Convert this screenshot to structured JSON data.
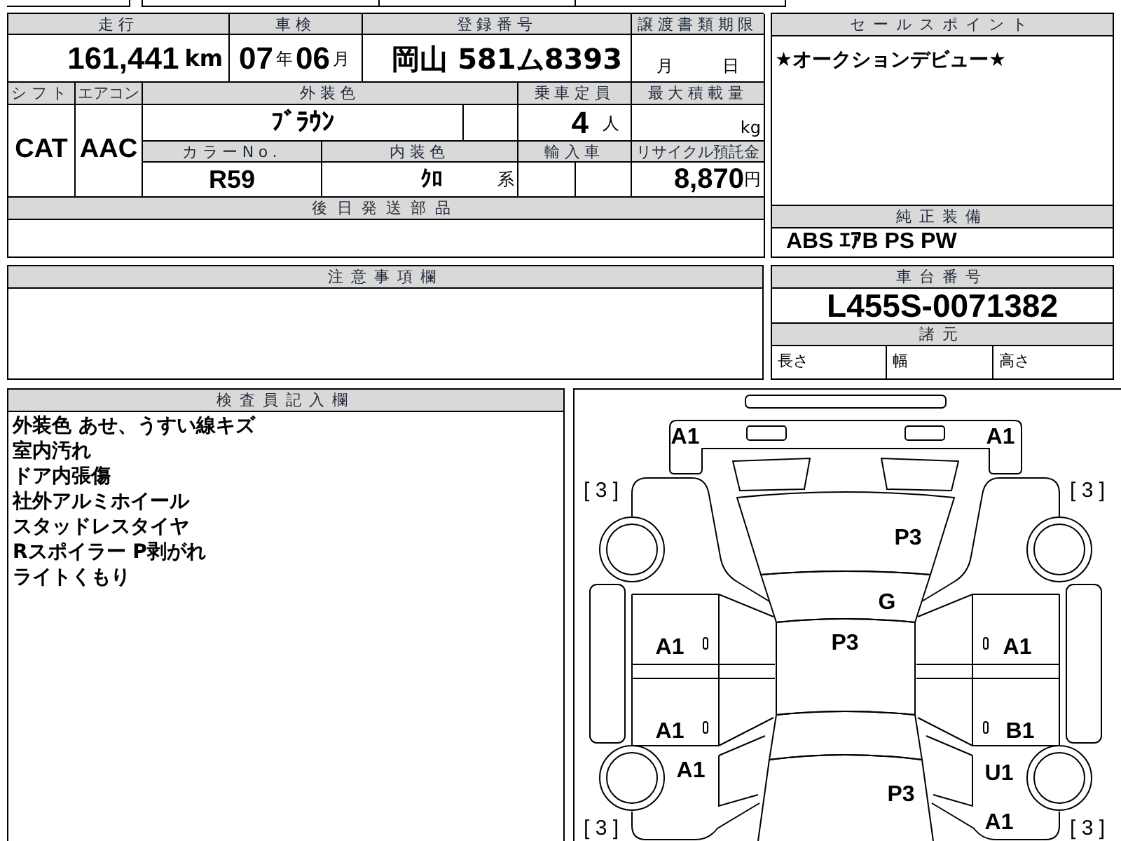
{
  "mileage": {
    "label": "走行",
    "value": "161,441",
    "unit": "km"
  },
  "inspection": {
    "label": "車検",
    "year": "07",
    "year_unit": "年",
    "month": "06",
    "month_unit": "月"
  },
  "registration": {
    "label": "登録番号",
    "value": "岡山 581ム8393"
  },
  "transfer_deadline": {
    "label": "譲渡書類期限",
    "month_unit": "月",
    "day_unit": "日"
  },
  "shift": {
    "label": "シフト",
    "value": "CAT"
  },
  "aircon": {
    "label": "エアコン",
    "value": "AAC"
  },
  "exterior_color": {
    "label": "外装色",
    "value": "ﾌﾞﾗｳﾝ"
  },
  "capacity": {
    "label": "乗車定員",
    "value": "4",
    "unit": "人"
  },
  "max_load": {
    "label": "最大積載量",
    "unit": "kg"
  },
  "color_no": {
    "label": "カラーNo.",
    "value": "R59"
  },
  "interior_color": {
    "label": "内装色",
    "value": "ｸﾛ",
    "suffix": "系"
  },
  "imported": {
    "label": "輸入車"
  },
  "recycling_deposit": {
    "label": "リサイクル預託金",
    "value": "8,870",
    "unit": "円"
  },
  "parts_sent_later": {
    "label": "後日発送部品"
  },
  "sales_point": {
    "label": "セールスポイント",
    "text": "★オークションデビュー★"
  },
  "standard_equipment": {
    "label": "純正装備",
    "text": "ABS ｴｱB PS PW"
  },
  "notes": {
    "label": "注意事項欄"
  },
  "chassis_number": {
    "label": "車台番号",
    "value": "L455S-0071382"
  },
  "specifications": {
    "label": "諸元",
    "items": [
      "長さ",
      "幅",
      "高さ"
    ]
  },
  "inspector_notes": {
    "label": "検査員記入欄",
    "lines": [
      "外装色 あせ、うすい線キズ",
      "室内汚れ",
      "ドア内張傷",
      "社外アルミホイール",
      "スタッドレスタイヤ",
      "Rスポイラー P剥がれ",
      "ライトくもり"
    ]
  },
  "diagram": {
    "marks": [
      {
        "kind": "damage",
        "text": "A1"
      },
      {
        "kind": "damage",
        "text": "A1"
      },
      {
        "kind": "tyre",
        "text": "[ 3 ]"
      },
      {
        "kind": "tyre",
        "text": "[ 3 ]"
      },
      {
        "kind": "damage",
        "text": "P3"
      },
      {
        "kind": "damage",
        "text": "G"
      },
      {
        "kind": "damage",
        "text": "A1"
      },
      {
        "kind": "damage",
        "text": "P3"
      },
      {
        "kind": "damage",
        "text": "A1"
      },
      {
        "kind": "damage",
        "text": "A1"
      },
      {
        "kind": "damage",
        "text": "B1"
      },
      {
        "kind": "damage",
        "text": "A1"
      },
      {
        "kind": "damage",
        "text": "U1"
      },
      {
        "kind": "damage",
        "text": "P3"
      },
      {
        "kind": "tyre",
        "text": "[ 3 ]"
      },
      {
        "kind": "damage",
        "text": "A1"
      },
      {
        "kind": "tyre",
        "text": "[ 3 ]"
      }
    ]
  }
}
